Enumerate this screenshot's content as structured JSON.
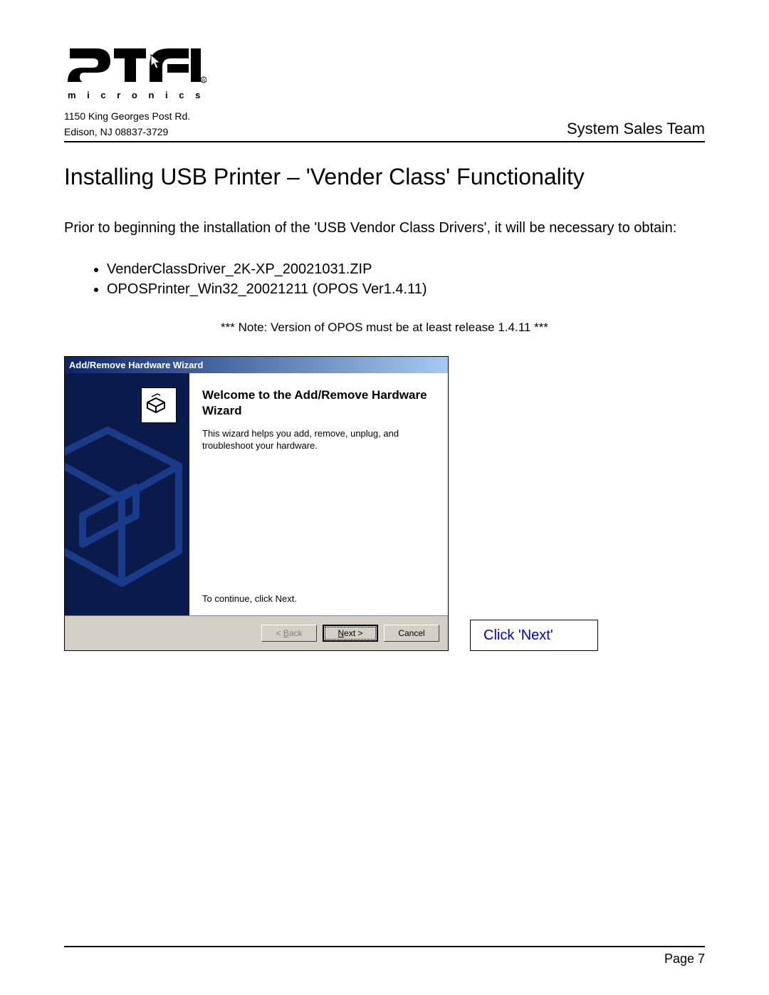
{
  "header": {
    "address_line1": "1150 King Georges Post Rd.",
    "address_line2": "Edison, NJ 08837-3729",
    "team": "System Sales Team"
  },
  "title": "Installing USB Printer – 'Vender Class' Functionality",
  "intro": "Prior to beginning the installation of the 'USB Vendor Class Drivers', it will be necessary to obtain:",
  "files": [
    "VenderClassDriver_2K-XP_20021031.ZIP",
    "OPOSPrinter_Win32_20021211 (OPOS Ver1.4.11)"
  ],
  "note": "*** Note: Version of OPOS must be at least release 1.4.11 ***",
  "wizard": {
    "title": "Add/Remove Hardware Wizard",
    "heading": "Welcome to the Add/Remove Hardware Wizard",
    "desc": "This wizard helps you add, remove, unplug, and troubleshoot your hardware.",
    "continue": "To continue, click Next.",
    "buttons": {
      "back": "< Back",
      "next": "Next >",
      "cancel": "Cancel"
    }
  },
  "callout": "Click 'Next'",
  "footer": "Page 7"
}
